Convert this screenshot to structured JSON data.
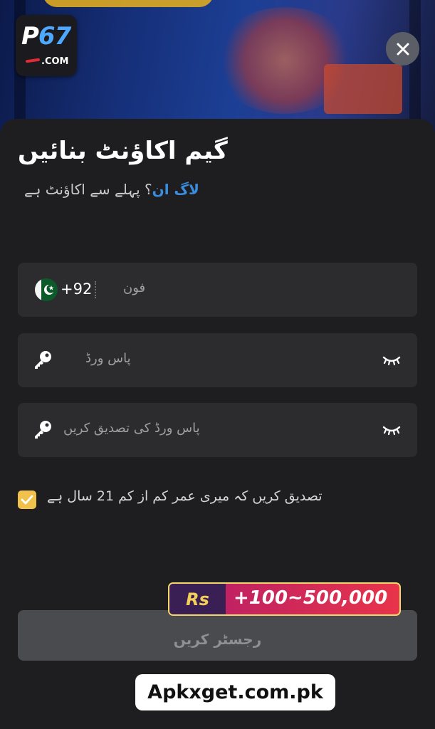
{
  "header": {
    "logo_text_p": "P",
    "logo_text_num": "67",
    "logo_text_com": ".COM",
    "close_label": "×"
  },
  "form": {
    "title": "گیم اکاؤنٹ بنائیں",
    "subtitle_text": "پہلے سے اکاؤنٹ ہے",
    "subtitle_q": "؟",
    "login_link": "لاگ ان",
    "phone": {
      "country_code": "+92",
      "placeholder": "فون"
    },
    "password": {
      "placeholder": "پاس ورڈ"
    },
    "confirm_password": {
      "placeholder": "پاس ورڈ کی تصدیق کریں"
    },
    "age_confirm": {
      "label": "تصدیق کریں کہ میری عمر کم از کم 21 سال ہے",
      "checked": true
    },
    "register_label": "رجسٹر کریں"
  },
  "promo": {
    "currency": "Rs",
    "amount": "+100~500,000"
  },
  "watermark": "Apkxget.com.pk",
  "colors": {
    "accent": "#3a8dde",
    "checkbox": "#f1c24b",
    "sheet": "#1e1e20",
    "field": "#2c2c2e"
  }
}
